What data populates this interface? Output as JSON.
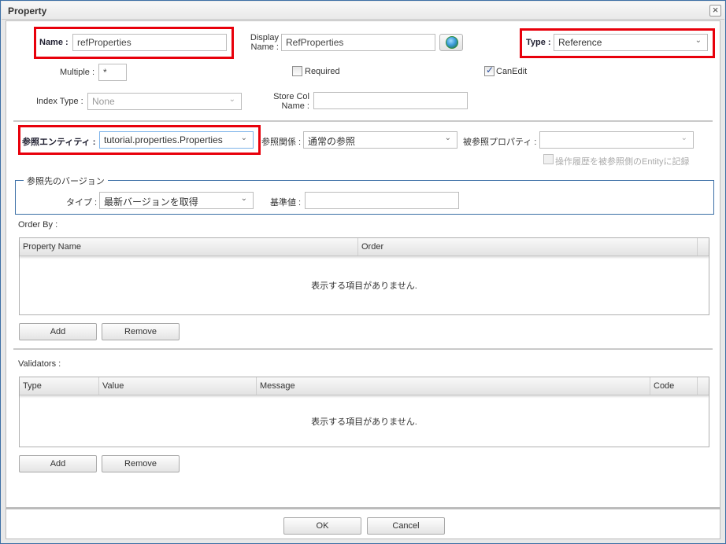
{
  "window": {
    "title": "Property",
    "close_label": "×"
  },
  "basic": {
    "name_label": "Name :",
    "name_value": "refProperties",
    "display_name_label_1": "Display",
    "display_name_label_2": "Name :",
    "display_name_value": "RefProperties",
    "globe_icon": "globe-icon",
    "type_label": "Type :",
    "type_value": "Reference",
    "multiple_label": "Multiple :",
    "multiple_value": "*",
    "required_label": "Required",
    "required_checked": false,
    "can_edit_label": "CanEdit",
    "can_edit_checked": true,
    "index_type_label": "Index Type :",
    "index_type_value": "None",
    "store_col_label_1": "Store Col",
    "store_col_label_2": "Name :",
    "store_col_value": ""
  },
  "reference": {
    "entity_label": "参照エンティティ :",
    "entity_value": "tutorial.properties.Properties",
    "relation_label": "参照関係 :",
    "relation_value": "通常の参照",
    "mapped_property_label": "被参照プロパティ :",
    "mapped_property_value": "",
    "history_label": "操作履歴を被参照側のEntityに記録",
    "history_checked": false,
    "version": {
      "legend": "参照先のバージョン",
      "type_label": "タイプ :",
      "type_value": "最新バージョンを取得",
      "base_value_label": "基準値 :",
      "base_value": ""
    }
  },
  "order_by": {
    "label": "Order By :",
    "columns": [
      "Property Name",
      "Order"
    ],
    "empty_message": "表示する項目がありません.",
    "add_label": "Add",
    "remove_label": "Remove"
  },
  "validators": {
    "label": "Validators :",
    "columns": [
      "Type",
      "Value",
      "Message",
      "Code"
    ],
    "empty_message": "表示する項目がありません.",
    "add_label": "Add",
    "remove_label": "Remove"
  },
  "footer": {
    "ok_label": "OK",
    "cancel_label": "Cancel"
  },
  "colors": {
    "highlight": "#e8000b",
    "window_border": "#3c6fa5",
    "fieldset_border": "#3a6ea5"
  }
}
